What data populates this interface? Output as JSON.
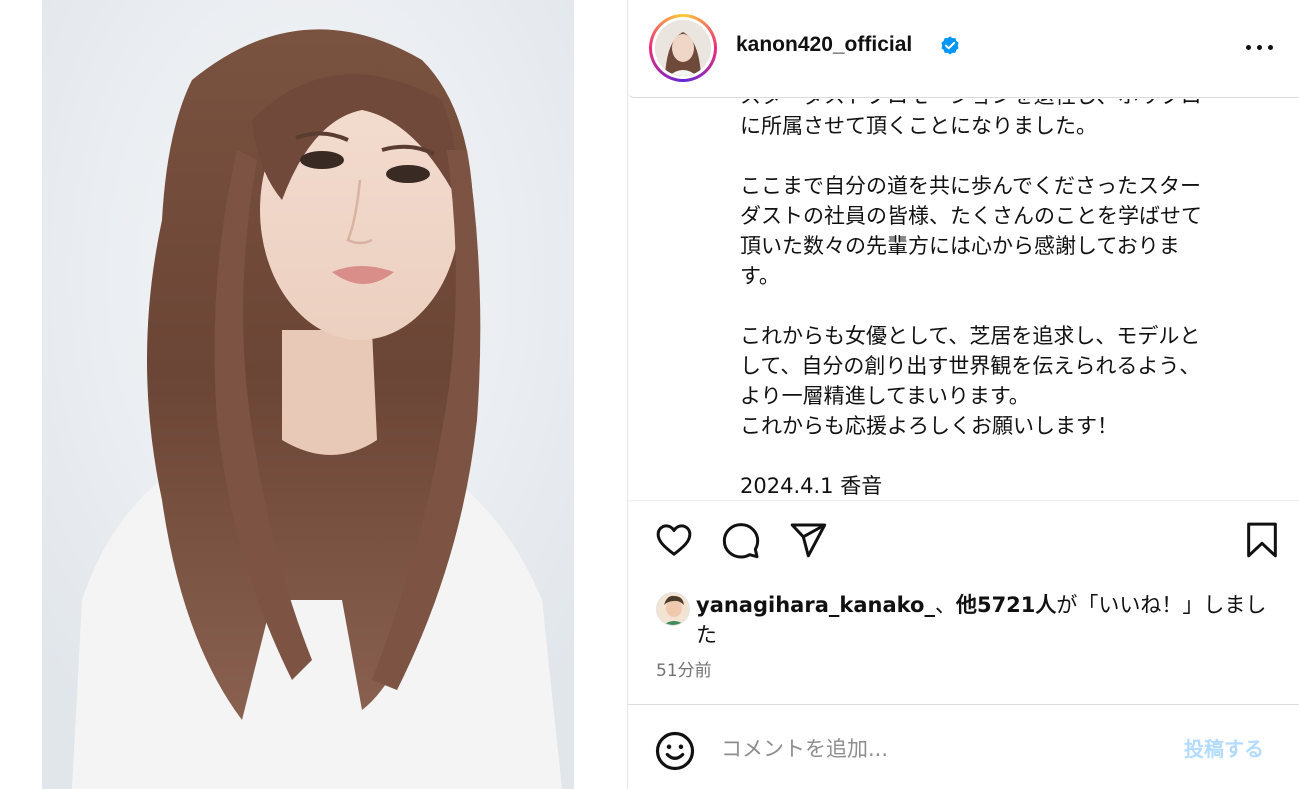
{
  "post": {
    "username": "kanon420_official",
    "verified": true,
    "verified_icon": "verified-badge-icon",
    "more_icon": "more-options-icon"
  },
  "caption": {
    "cut_line": "スターダストプロモーションを退社し、ホリプロ",
    "line_1": "に所属させて頂くことになりました。",
    "para_2": "ここまで自分の道を共に歩んでくださったスター\nダストの社員の皆様、たくさんのことを学ばせて\n頂いた数々の先輩方には心から感謝しておりま\nす。",
    "para_3": "これからも女優として、芝居を追求し、モデルと\nして、自分の創り出す世界観を伝えられるよう、\nより一層精進してまいります。\nこれからも応援よろしくお願いします！",
    "signature": "2024.4.1 香音"
  },
  "actions": {
    "like_icon": "heart-icon",
    "comment_icon": "comment-icon",
    "share_icon": "share-icon",
    "save_icon": "bookmark-icon"
  },
  "likes": {
    "liker": "yanagihara_kanako_",
    "sep": "、",
    "count_text": "他5721人",
    "suffix": "が「いいね！」しました"
  },
  "timestamp": "51分前",
  "comment": {
    "placeholder": "コメントを追加...",
    "post_label": "投稿する",
    "emoji_icon": "emoji-icon"
  },
  "colors": {
    "accent": "#0095f6",
    "post_disabled": "#b3dbff",
    "muted": "#737373"
  }
}
